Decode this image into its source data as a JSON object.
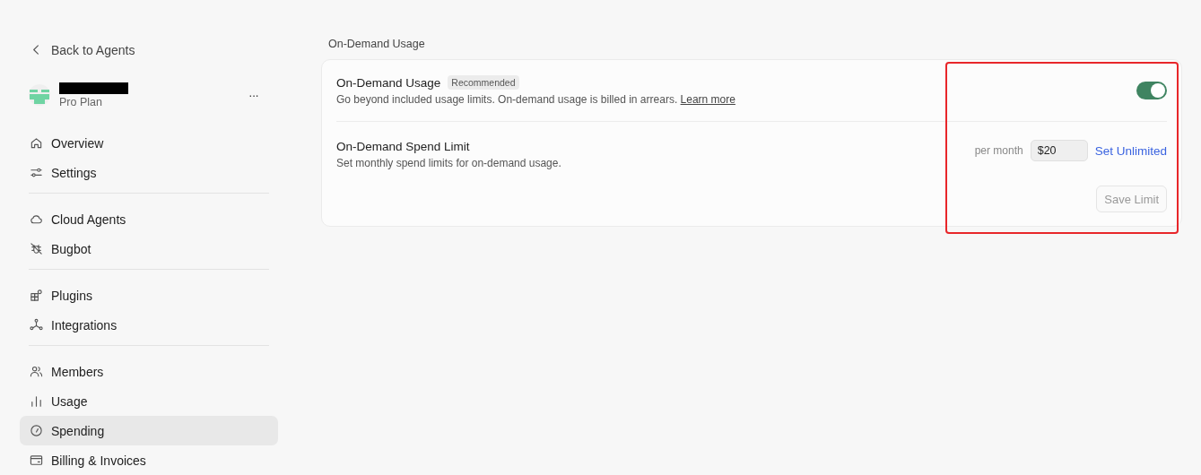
{
  "sidebar": {
    "back_link": "Back to Agents",
    "account": {
      "plan": "Pro Plan",
      "menu": "···"
    },
    "groups": [
      [
        {
          "label": "Overview",
          "selected": false
        },
        {
          "label": "Settings",
          "selected": false
        }
      ],
      [
        {
          "label": "Cloud Agents",
          "selected": false
        },
        {
          "label": "Bugbot",
          "selected": false
        }
      ],
      [
        {
          "label": "Plugins",
          "selected": false
        },
        {
          "label": "Integrations",
          "selected": false
        }
      ],
      [
        {
          "label": "Members",
          "selected": false
        },
        {
          "label": "Usage",
          "selected": false
        },
        {
          "label": "Spending",
          "selected": true
        },
        {
          "label": "Billing & Invoices",
          "selected": false
        }
      ]
    ]
  },
  "main": {
    "section_title": "On-Demand Usage",
    "usage": {
      "title": "On-Demand Usage",
      "badge": "Recommended",
      "description": "Go beyond included usage limits. On-demand usage is billed in arrears.",
      "link": "Learn more",
      "on": true
    },
    "limit": {
      "title": "On-Demand Spend Limit",
      "description": "Set monthly spend limits for on-demand usage.",
      "period": "per month",
      "value": "$20",
      "unlimited": "Set Unlimited",
      "save": "Save Limit",
      "save_disabled": true
    }
  }
}
